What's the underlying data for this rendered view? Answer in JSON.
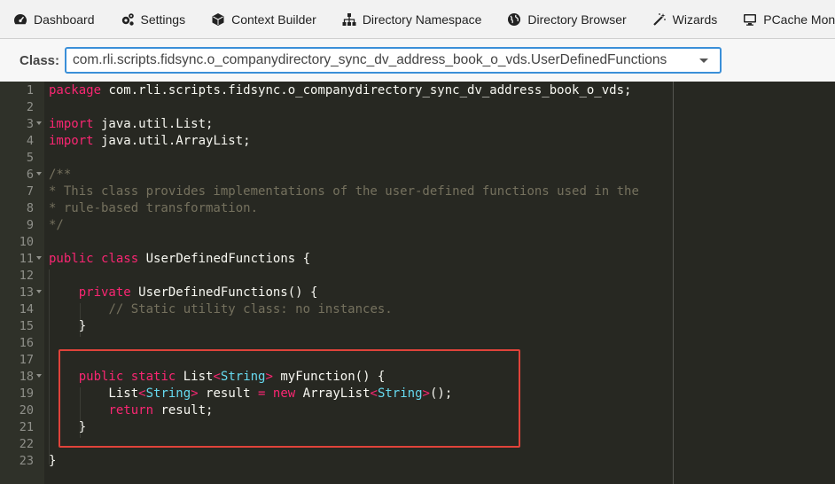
{
  "nav": {
    "items": [
      {
        "label": "Dashboard",
        "icon": "dashboard-icon"
      },
      {
        "label": "Settings",
        "icon": "gears-icon"
      },
      {
        "label": "Context Builder",
        "icon": "cube-icon"
      },
      {
        "label": "Directory Namespace",
        "icon": "sitemap-icon"
      },
      {
        "label": "Directory Browser",
        "icon": "globe-icon"
      },
      {
        "label": "Wizards",
        "icon": "magic-wand-icon"
      },
      {
        "label": "PCache Monitoring",
        "icon": "monitor-icon"
      }
    ]
  },
  "classbar": {
    "label": "Class:",
    "selected": "com.rli.scripts.fidsync.o_companydirectory_sync_dv_address_book_o_vds.UserDefinedFunctions"
  },
  "editor": {
    "theme_colors": {
      "background": "#272822",
      "keyword": "#f92672",
      "type": "#66d9ef",
      "comment": "#75715e",
      "text": "#f8f8f2"
    },
    "lines": [
      {
        "n": "1",
        "fold": false,
        "tokens": [
          {
            "t": "package",
            "c": "kw"
          },
          {
            "t": " com.rli.scripts.fidsync.o_companydirectory_sync_dv_address_book_o_vds;",
            "c": "tx"
          }
        ]
      },
      {
        "n": "2",
        "fold": false,
        "tokens": []
      },
      {
        "n": "3",
        "fold": true,
        "tokens": [
          {
            "t": "import",
            "c": "kw"
          },
          {
            "t": " java.util.List;",
            "c": "tx"
          }
        ]
      },
      {
        "n": "4",
        "fold": false,
        "tokens": [
          {
            "t": "import",
            "c": "kw"
          },
          {
            "t": " java.util.ArrayList;",
            "c": "tx"
          }
        ]
      },
      {
        "n": "5",
        "fold": false,
        "tokens": []
      },
      {
        "n": "6",
        "fold": true,
        "tokens": [
          {
            "t": "/**",
            "c": "cm"
          }
        ]
      },
      {
        "n": "7",
        "fold": false,
        "tokens": [
          {
            "t": "* This class provides implementations of the user-defined functions used in the",
            "c": "cm"
          }
        ]
      },
      {
        "n": "8",
        "fold": false,
        "tokens": [
          {
            "t": "* rule-based transformation.",
            "c": "cm"
          }
        ]
      },
      {
        "n": "9",
        "fold": false,
        "tokens": [
          {
            "t": "*/",
            "c": "cm"
          }
        ]
      },
      {
        "n": "10",
        "fold": false,
        "tokens": []
      },
      {
        "n": "11",
        "fold": true,
        "tokens": [
          {
            "t": "public",
            "c": "kw"
          },
          {
            "t": " ",
            "c": "tx"
          },
          {
            "t": "class",
            "c": "kw"
          },
          {
            "t": " UserDefinedFunctions {",
            "c": "tx"
          }
        ]
      },
      {
        "n": "12",
        "fold": false,
        "tokens": []
      },
      {
        "n": "13",
        "fold": true,
        "tokens": [
          {
            "t": "    ",
            "c": "tx"
          },
          {
            "t": "private",
            "c": "kw"
          },
          {
            "t": " UserDefinedFunctions() {",
            "c": "tx"
          }
        ]
      },
      {
        "n": "14",
        "fold": false,
        "tokens": [
          {
            "t": "        ",
            "c": "tx"
          },
          {
            "t": "// Static utility class: no instances.",
            "c": "cm"
          }
        ]
      },
      {
        "n": "15",
        "fold": false,
        "tokens": [
          {
            "t": "    }",
            "c": "tx"
          }
        ]
      },
      {
        "n": "16",
        "fold": false,
        "tokens": []
      },
      {
        "n": "17",
        "fold": false,
        "tokens": []
      },
      {
        "n": "18",
        "fold": true,
        "tokens": [
          {
            "t": "    ",
            "c": "tx"
          },
          {
            "t": "public",
            "c": "kw"
          },
          {
            "t": " ",
            "c": "tx"
          },
          {
            "t": "static",
            "c": "kw"
          },
          {
            "t": " List",
            "c": "tx"
          },
          {
            "t": "<",
            "c": "kw"
          },
          {
            "t": "String",
            "c": "cls"
          },
          {
            "t": ">",
            "c": "kw"
          },
          {
            "t": " myFunction() {",
            "c": "tx"
          }
        ]
      },
      {
        "n": "19",
        "fold": false,
        "tokens": [
          {
            "t": "        List",
            "c": "tx"
          },
          {
            "t": "<",
            "c": "kw"
          },
          {
            "t": "String",
            "c": "cls"
          },
          {
            "t": ">",
            "c": "kw"
          },
          {
            "t": " result ",
            "c": "tx"
          },
          {
            "t": "=",
            "c": "kw"
          },
          {
            "t": " ",
            "c": "tx"
          },
          {
            "t": "new",
            "c": "kw"
          },
          {
            "t": " ArrayList",
            "c": "tx"
          },
          {
            "t": "<",
            "c": "kw"
          },
          {
            "t": "String",
            "c": "cls"
          },
          {
            "t": ">",
            "c": "kw"
          },
          {
            "t": "();",
            "c": "tx"
          }
        ]
      },
      {
        "n": "20",
        "fold": false,
        "tokens": [
          {
            "t": "        ",
            "c": "tx"
          },
          {
            "t": "return",
            "c": "kw"
          },
          {
            "t": " result;",
            "c": "tx"
          }
        ]
      },
      {
        "n": "21",
        "fold": false,
        "tokens": [
          {
            "t": "    }",
            "c": "tx"
          }
        ]
      },
      {
        "n": "22",
        "fold": false,
        "tokens": []
      },
      {
        "n": "23",
        "fold": false,
        "tokens": [
          {
            "t": "}",
            "c": "tx"
          }
        ]
      }
    ]
  }
}
